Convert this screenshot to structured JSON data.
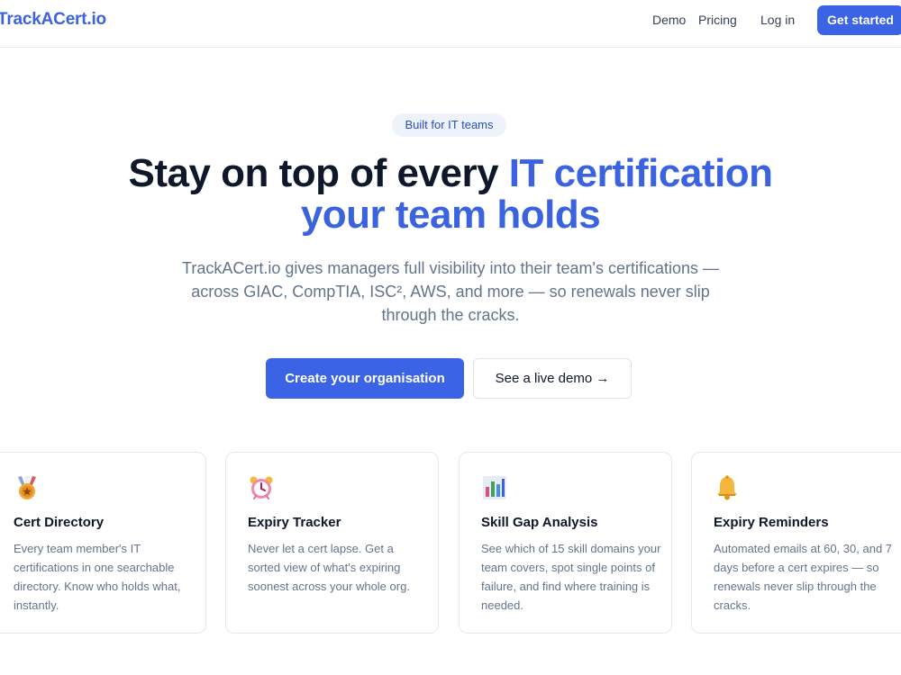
{
  "header": {
    "logo": "TrackACert.io",
    "nav": {
      "demo": "Demo",
      "pricing": "Pricing",
      "login": "Log in",
      "get_started": "Get started"
    }
  },
  "hero": {
    "badge": "Built for IT teams",
    "headline_plain": "Stay on top of every ",
    "headline_accent_1": "IT certification",
    "headline_accent_2": "your team holds",
    "subtext": "TrackACert.io gives managers full visibility into their team's certifications — across GIAC, CompTIA, ISC², AWS, and more — so renewals never slip through the cracks.",
    "primary_cta": "Create your organisation",
    "secondary_cta": "See a live demo →"
  },
  "features": [
    {
      "icon": "medal-icon",
      "title": "Cert Directory",
      "description": "Every team member's IT certifications in one searchable directory. Know who holds what, instantly."
    },
    {
      "icon": "alarm-clock-icon",
      "title": "Expiry Tracker",
      "description": "Never let a cert lapse. Get a sorted view of what's expiring soonest across your whole org."
    },
    {
      "icon": "bar-chart-icon",
      "title": "Skill Gap Analysis",
      "description": "See which of 15 skill domains your team covers, spot single points of failure, and find where training is needed."
    },
    {
      "icon": "bell-icon",
      "title": "Expiry Reminders",
      "description": "Automated emails at 60, 30, and 7 days before a cert expires — so renewals never slip through the cracks."
    }
  ],
  "colors": {
    "accent": "#3b63e6",
    "heading": "#0f172a",
    "muted": "#64748b",
    "badge_bg": "#eef2fb"
  }
}
